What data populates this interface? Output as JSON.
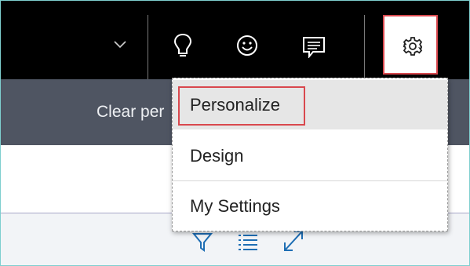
{
  "actionbar": {
    "clear_text": "Clear per"
  },
  "menu": {
    "items": [
      {
        "label": "Personalize"
      },
      {
        "label": "Design"
      },
      {
        "label": "My Settings"
      }
    ]
  },
  "icons": {
    "dropdown": "chevron-down-icon",
    "ideas": "lightbulb-icon",
    "feedback": "smiley-icon",
    "messages": "message-icon",
    "settings": "gear-icon",
    "filter": "filter-icon",
    "list": "list-icon",
    "expand": "expand-icon"
  },
  "colors": {
    "topbar": "#000000",
    "actionbar": "#4f5562",
    "highlight": "#d9484e",
    "accent": "#1e6eb4"
  }
}
